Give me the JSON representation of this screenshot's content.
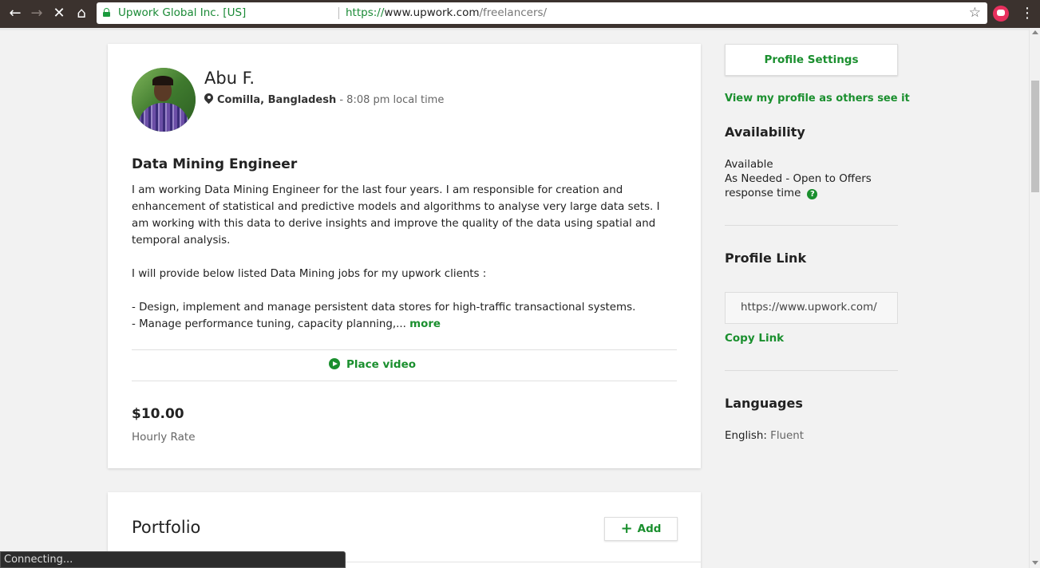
{
  "browser": {
    "org": "Upwork Global Inc. [US]",
    "url_scheme": "https://",
    "url_host": "www.upwork.com",
    "url_path": "/freelancers/",
    "status_text": "Connecting..."
  },
  "profile": {
    "name": "Abu F.",
    "location": "Comilla, Bangladesh",
    "local_time": " - 8:08 pm local time",
    "title": "Data Mining Engineer",
    "description_p1": "I am working Data Mining Engineer for the last four years. I am responsible for creation and enhancement of statistical and predictive models and algorithms to analyse very large data sets. I am working with this data to derive insights and improve the quality of the data using spatial and temporal analysis.",
    "description_p2": "I will provide below listed Data Mining jobs for my upwork clients :",
    "description_p3": "- Design, implement and manage persistent data stores for high-traffic transactional systems.",
    "description_p4": "- Manage performance tuning, capacity planning,... ",
    "more_label": "more",
    "place_video_label": "Place video",
    "hourly_rate": "$10.00",
    "hourly_rate_label": "Hourly Rate"
  },
  "portfolio": {
    "title": "Portfolio",
    "add_label": "Add"
  },
  "sidebar": {
    "settings_label": "Profile Settings",
    "view_link": "View my profile as others see it",
    "availability_heading": "Availability",
    "availability_status": "Available",
    "availability_hours": "As Needed - Open to Offers",
    "availability_response": "response time",
    "help_glyph": "?",
    "profile_link_heading": "Profile Link",
    "profile_link_value": "https://www.upwork.com/",
    "copy_link_label": "Copy Link",
    "languages_heading": "Languages",
    "language_name": "English:",
    "language_level": " Fluent"
  },
  "colors": {
    "accent": "#1a8f2e",
    "chrome": "#3b322e"
  }
}
